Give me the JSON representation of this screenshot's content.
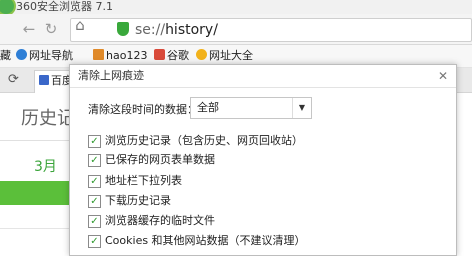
{
  "window": {
    "title": "360安全浏览器 7.1",
    "url_scheme": "se://",
    "url_path": "history/"
  },
  "bookmarks": [
    {
      "label": "藏",
      "icon": "bookmark-icon"
    },
    {
      "label": "网址导航",
      "icon": "globe-icon"
    },
    {
      "label": "hao123",
      "icon": "hao123-icon"
    },
    {
      "label": "谷歌",
      "icon": "google-icon"
    },
    {
      "label": "网址大全",
      "icon": "star-icon"
    }
  ],
  "tab": {
    "label": "百度"
  },
  "page": {
    "heading": "历史记",
    "month": "3月"
  },
  "dialog": {
    "title": "清除上网痕迹",
    "range_label": "清除这段时间的数据：",
    "range_value": "全部",
    "options": [
      {
        "label": "浏览历史记录（包含历史、网页回收站）",
        "checked": true
      },
      {
        "label": "已保存的网页表单数据",
        "checked": true
      },
      {
        "label": "地址栏下拉列表",
        "checked": true
      },
      {
        "label": "下载历史记录",
        "checked": true
      },
      {
        "label": "浏览器缓存的临时文件",
        "checked": true
      },
      {
        "label": "Cookies 和其他网站数据（不建议清理）",
        "checked": true
      }
    ]
  },
  "colors": {
    "accent_green": "#5bbf3a",
    "shield_green": "#39a83b"
  }
}
